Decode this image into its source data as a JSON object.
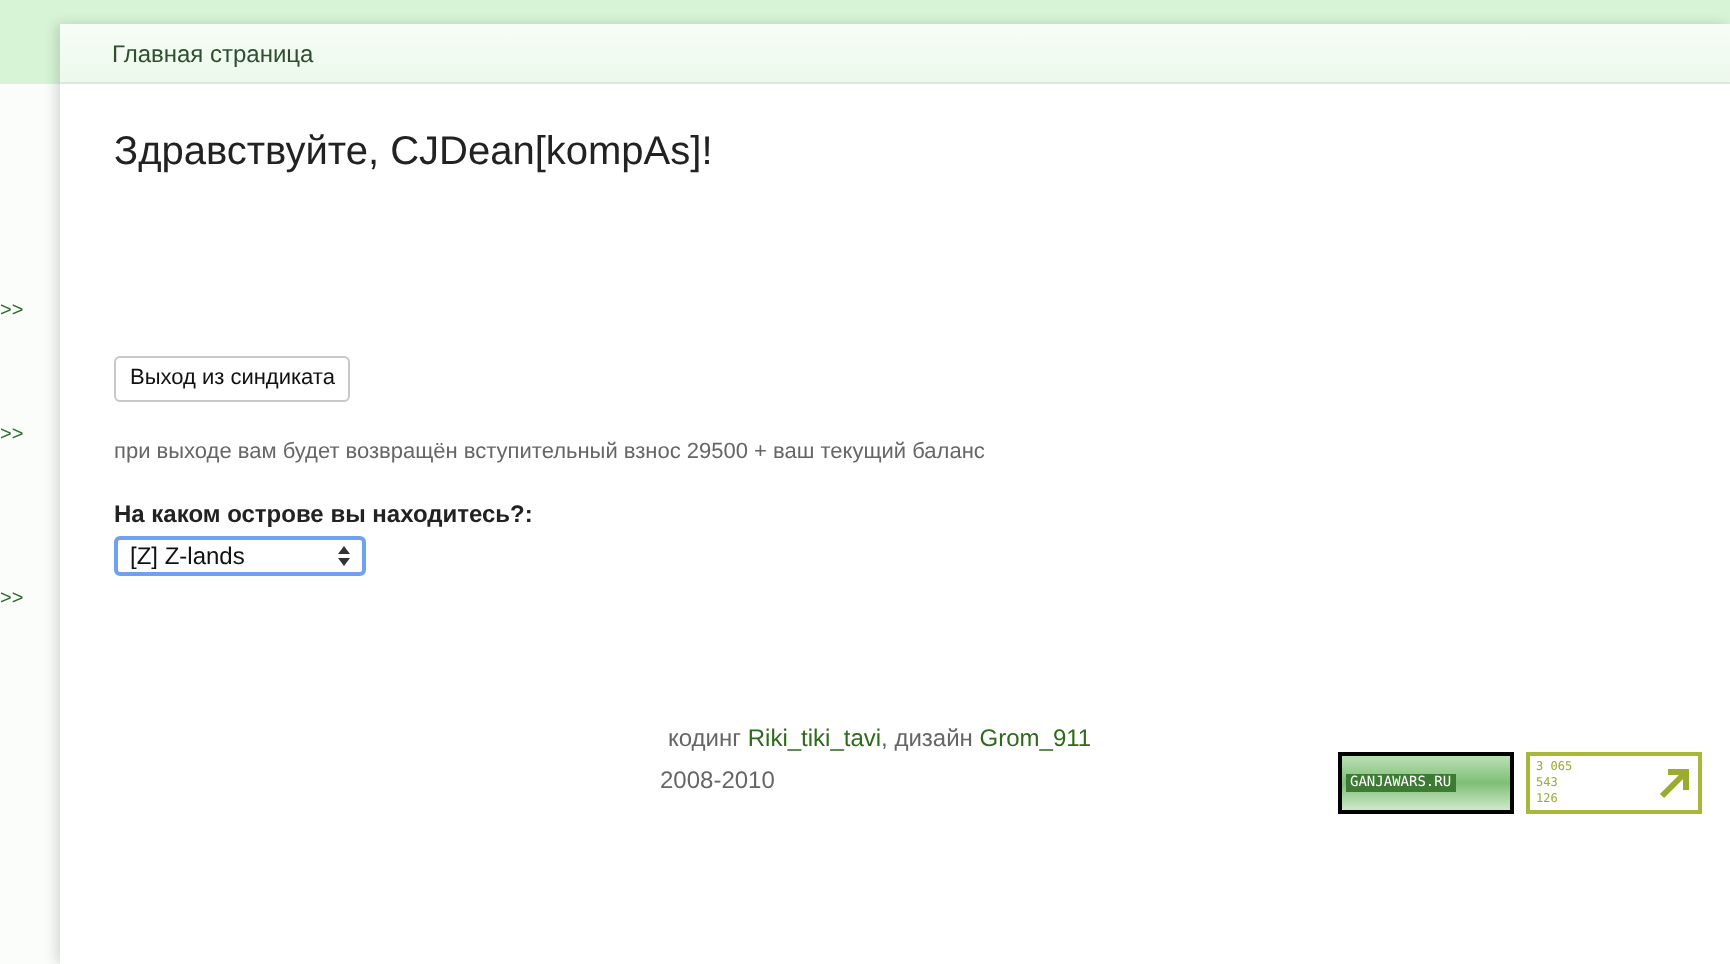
{
  "side_marks": [
    ">>",
    ">>",
    ">>"
  ],
  "breadcrumb": "Главная страница",
  "greeting": "Здравствуйте, CJDean[kompAs]!",
  "leave_button": "Выход из синдиката",
  "note": "при выходе вам будет возвращён вступительный взнос 29500 + ваш текущий баланс",
  "island": {
    "label": "На каком острове вы находитесь?:",
    "value": "[Z] Z-lands"
  },
  "footer": {
    "coding_label": "кодинг",
    "coder": "Riki_tiki_tavi",
    "design_label": ", дизайн",
    "designer": "Grom_911",
    "years": "2008-2010"
  },
  "banners": {
    "site_banner": "GANJAWARS.RU",
    "counter": [
      "3 065",
      "543",
      "126"
    ]
  }
}
